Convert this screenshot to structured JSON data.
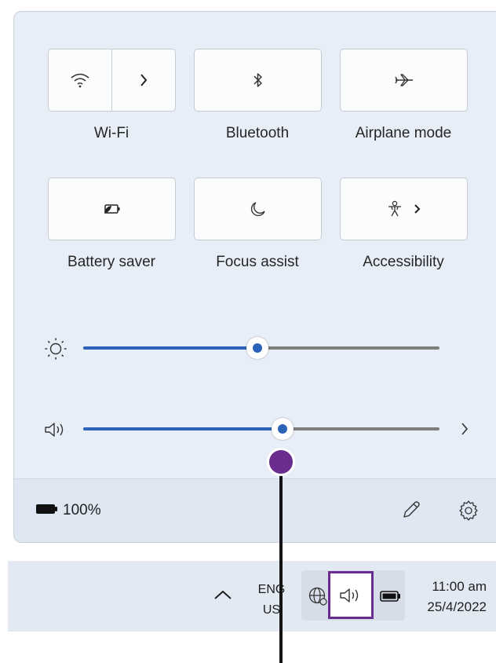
{
  "quick_settings": {
    "tiles": [
      {
        "label": "Wi-Fi",
        "icon": "wifi-icon",
        "secondary_icon": "chevron-right-icon"
      },
      {
        "label": "Bluetooth",
        "icon": "bluetooth-icon"
      },
      {
        "label": "Airplane mode",
        "icon": "airplane-icon"
      },
      {
        "label": "Battery saver",
        "icon": "battery-saver-icon"
      },
      {
        "label": "Focus assist",
        "icon": "moon-icon"
      },
      {
        "label": "Accessibility",
        "icon": "accessibility-icon",
        "secondary_icon": "chevron-right-icon"
      }
    ],
    "brightness": {
      "icon": "brightness-icon",
      "level": 0.49
    },
    "volume": {
      "icon": "speaker-icon",
      "level": 0.56,
      "more_icon": "chevron-right-icon"
    },
    "footer": {
      "battery_percent": "100%",
      "edit_icon": "pencil-icon",
      "settings_icon": "gear-icon"
    }
  },
  "taskbar": {
    "overflow_icon": "chevron-up-icon",
    "language": {
      "line1": "ENG",
      "line2": "US"
    },
    "network_icon": "globe-icon",
    "volume_icon": "speaker-icon",
    "battery_icon": "battery-icon",
    "clock": {
      "time": "11:00 am",
      "date": "25/4/2022"
    }
  },
  "colors": {
    "accent": "#2a63b8",
    "callout": "#6a2c8e",
    "panel_bg": "#e8eef8"
  }
}
